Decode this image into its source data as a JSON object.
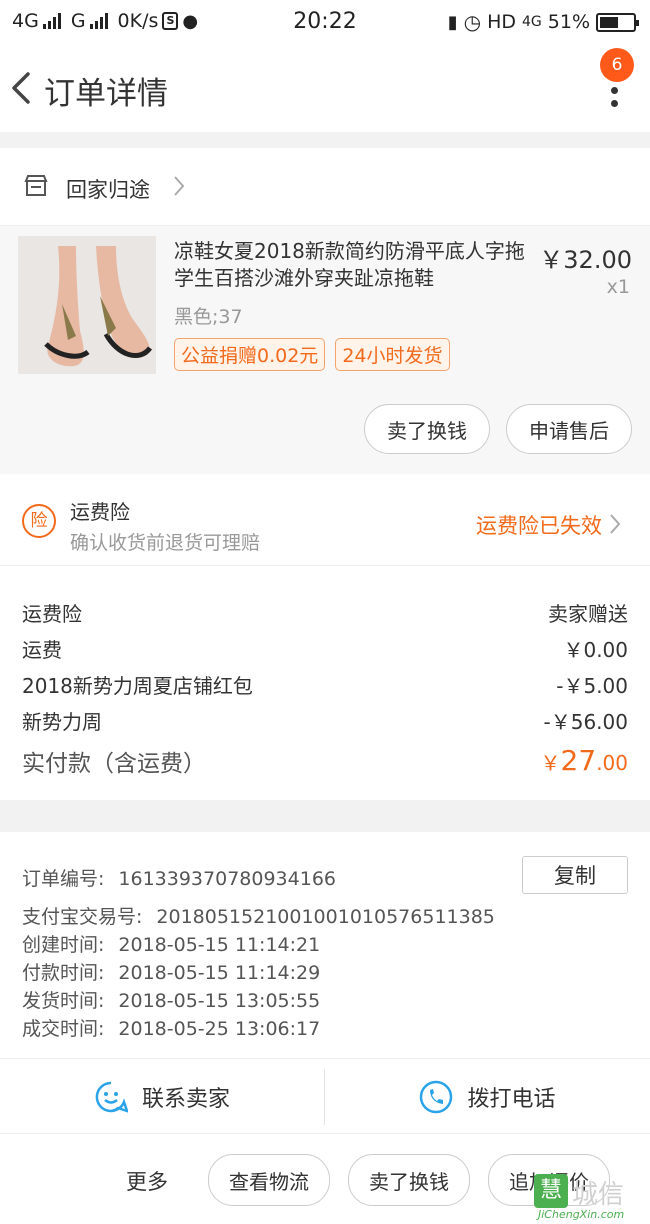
{
  "statusbar": {
    "left_text": "4G",
    "g_label": "G",
    "speed": "0K/s",
    "s_icon": "S",
    "time": "20:22",
    "hd": "HD",
    "net": "4G",
    "battery": "51%"
  },
  "nav": {
    "title": "订单详情",
    "badge": "6"
  },
  "shop": {
    "name": "回家归途"
  },
  "item": {
    "title": "凉鞋女夏2018新款简约防滑平底人字拖学生百搭沙滩外穿夹趾凉拖鞋",
    "price": "￥32.00",
    "qty": "x1",
    "sku": "黑色;37",
    "tags": [
      "公益捐赠0.02元",
      "24小时发货"
    ],
    "buttons": [
      "卖了换钱",
      "申请售后"
    ]
  },
  "insurance": {
    "title": "运费险",
    "subtitle": "确认收货前退货可理赔",
    "status": "运费险已失效",
    "icon_char": "险"
  },
  "fees": {
    "rows": [
      {
        "label": "运费险",
        "value": "卖家赠送"
      },
      {
        "label": "运费",
        "value": "￥0.00"
      },
      {
        "label": "2018新势力周夏店铺红包",
        "value": "-￥5.00"
      },
      {
        "label": "新势力周",
        "value": "-￥56.00"
      }
    ],
    "total_label": "实付款（含运费）",
    "total_symbol": "￥",
    "total_int": "27",
    "total_dec": ".00"
  },
  "order_info": {
    "copy_label": "复制",
    "rows": [
      {
        "label": "订单编号:",
        "value": "161339370780934166"
      },
      {
        "label": "支付宝交易号:",
        "value": "2018051521001001010576511385"
      },
      {
        "label": "创建时间:",
        "value": "2018-05-15 11:14:21"
      },
      {
        "label": "付款时间:",
        "value": "2018-05-15 11:14:29"
      },
      {
        "label": "发货时间:",
        "value": "2018-05-15 13:05:55"
      },
      {
        "label": "成交时间:",
        "value": "2018-05-25 13:06:17"
      }
    ]
  },
  "contact": {
    "seller": "联系卖家",
    "phone": "拨打电话"
  },
  "bottom": {
    "more": "更多",
    "buttons": [
      "查看物流",
      "卖了换钱",
      "追加评价"
    ]
  },
  "watermark": {
    "text": "城信",
    "box": "慧",
    "sub": "JiChengXin.com"
  },
  "colors": {
    "accent": "#f26a1b",
    "badge": "#ff5a1a",
    "contact_icon": "#2aa3e8"
  }
}
